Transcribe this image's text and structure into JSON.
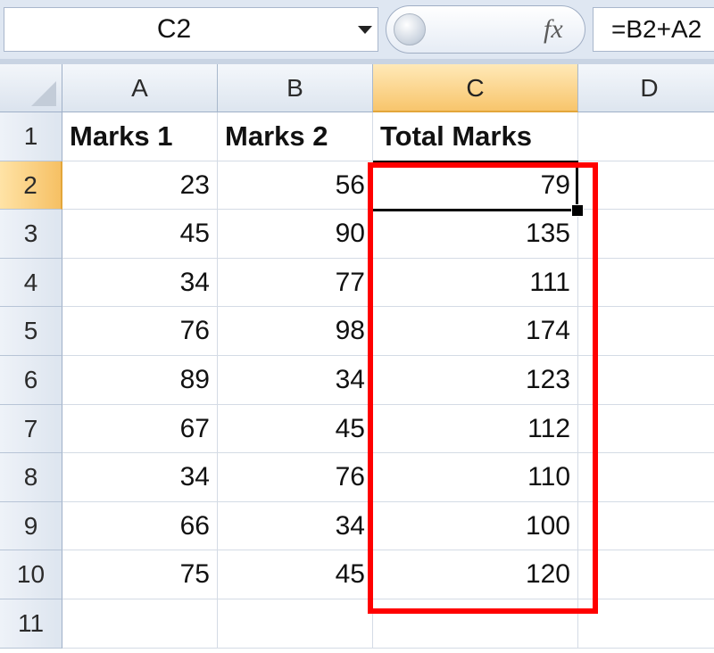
{
  "formula_bar": {
    "name_box": "C2",
    "fx_icon": "fx-icon",
    "formula": "=B2+A2"
  },
  "columns": [
    {
      "label": "A"
    },
    {
      "label": "B"
    },
    {
      "label": "C",
      "active": true
    },
    {
      "label": "D"
    }
  ],
  "rows": [
    {
      "num": "1",
      "a": "Marks 1",
      "b": "Marks 2",
      "c": "Total Marks",
      "header": true
    },
    {
      "num": "2",
      "a": "23",
      "b": "56",
      "c": "79",
      "active": true
    },
    {
      "num": "3",
      "a": "45",
      "b": "90",
      "c": "135"
    },
    {
      "num": "4",
      "a": "34",
      "b": "77",
      "c": "111"
    },
    {
      "num": "5",
      "a": "76",
      "b": "98",
      "c": "174"
    },
    {
      "num": "6",
      "a": "89",
      "b": "34",
      "c": "123"
    },
    {
      "num": "7",
      "a": "67",
      "b": "45",
      "c": "112"
    },
    {
      "num": "8",
      "a": "34",
      "b": "76",
      "c": "110"
    },
    {
      "num": "9",
      "a": "66",
      "b": "34",
      "c": "100"
    },
    {
      "num": "10",
      "a": "75",
      "b": "45",
      "c": "120"
    },
    {
      "num": "11",
      "a": "",
      "b": "",
      "c": ""
    }
  ],
  "selected_cell": "C2",
  "highlight": {
    "color": "#ff0000",
    "range": "C2:C10"
  },
  "colors": {
    "active_header": "#f8c56c",
    "header_bg": "#dde5ef",
    "gridline": "#d4dbe5"
  }
}
